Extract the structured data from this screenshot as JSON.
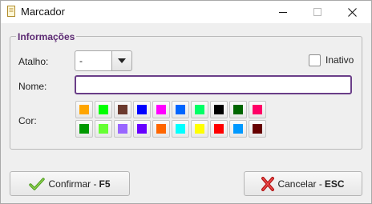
{
  "window": {
    "title": "Marcador"
  },
  "group": {
    "legend": "Informações"
  },
  "fields": {
    "atalho_label": "Atalho:",
    "atalho_value": "-",
    "inativo_label": "Inativo",
    "inativo_checked": false,
    "nome_label": "Nome:",
    "nome_value": "",
    "cor_label": "Cor:"
  },
  "colors": {
    "row1": [
      "#ffa500",
      "#00ff00",
      "#6b3a2e",
      "#0000ff",
      "#ff00ff",
      "#0066ff",
      "#00ff66",
      "#000000",
      "#006600",
      "#ff0066"
    ],
    "row2": [
      "#009900",
      "#66ff33",
      "#9966ff",
      "#6600ff",
      "#ff6600",
      "#00ffff",
      "#ffff00",
      "#ff0000",
      "#0099ff",
      "#660000"
    ]
  },
  "buttons": {
    "confirm_label": "Confirmar - ",
    "confirm_key": "F5",
    "cancel_label": "Cancelar - ",
    "cancel_key": "ESC"
  }
}
